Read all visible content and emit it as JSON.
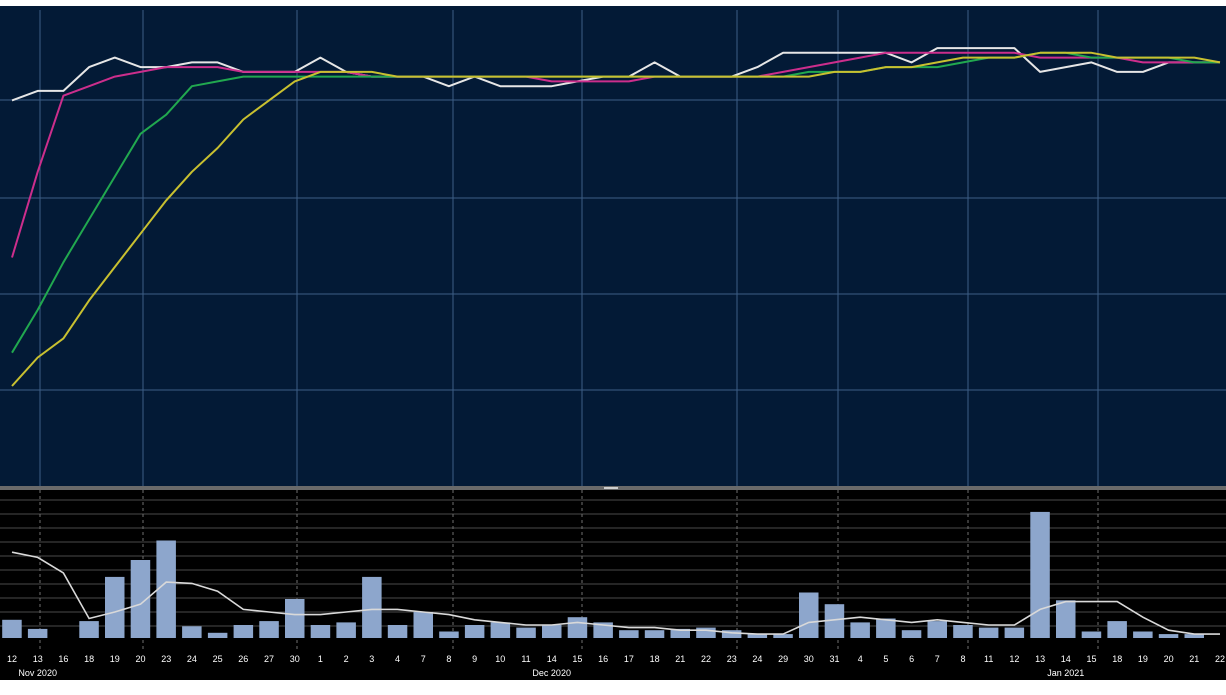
{
  "chart_data": [
    {
      "type": "line",
      "title": "",
      "grid": true,
      "colors": {
        "background": "#031a36",
        "grid": "#3d5e86",
        "price": "#e6e6e6",
        "ma_short": "#cc2e8c",
        "ma_mid": "#21a84f",
        "ma_long": "#c8c030"
      },
      "y_range": [
        0,
        100
      ],
      "x": [
        "12",
        "13",
        "16",
        "18",
        "19",
        "20",
        "23",
        "24",
        "25",
        "26",
        "27",
        "30",
        "1",
        "2",
        "3",
        "4",
        "7",
        "8",
        "9",
        "10",
        "11",
        "14",
        "15",
        "16",
        "17",
        "18",
        "21",
        "22",
        "23",
        "24",
        "29",
        "30",
        "31",
        "4",
        "5",
        "6",
        "7",
        "8",
        "11",
        "12",
        "13",
        "14",
        "15",
        "18",
        "19",
        "20",
        "21",
        "22"
      ],
      "series": [
        {
          "key": "price",
          "values": [
            81,
            83,
            83,
            88,
            90,
            88,
            88,
            89,
            89,
            87,
            87,
            87,
            90,
            87,
            86,
            86,
            86,
            84,
            86,
            84,
            84,
            84,
            85,
            86,
            86,
            89,
            86,
            86,
            86,
            88,
            91,
            91,
            91,
            91,
            91,
            89,
            92,
            92,
            92,
            92,
            87,
            88,
            89,
            87,
            87,
            89,
            89,
            89
          ]
        },
        {
          "key": "ma_short",
          "values": [
            48,
            66,
            82,
            84,
            86,
            87,
            88,
            88,
            88,
            87,
            87,
            87,
            87,
            87,
            86,
            86,
            86,
            86,
            86,
            86,
            86,
            85,
            85,
            85,
            85,
            86,
            86,
            86,
            86,
            86,
            87,
            88,
            89,
            90,
            91,
            91,
            91,
            91,
            91,
            91,
            90,
            90,
            90,
            90,
            89,
            89,
            89,
            89
          ]
        },
        {
          "key": "ma_mid",
          "values": [
            28,
            37,
            47,
            56,
            65,
            74,
            78,
            84,
            85,
            86,
            86,
            86,
            86,
            86,
            86,
            86,
            86,
            86,
            86,
            86,
            86,
            86,
            86,
            86,
            86,
            86,
            86,
            86,
            86,
            86,
            86,
            87,
            87,
            87,
            88,
            88,
            88,
            89,
            90,
            90,
            91,
            91,
            90,
            90,
            90,
            90,
            89,
            89
          ]
        },
        {
          "key": "ma_long",
          "values": [
            21,
            27,
            31,
            39,
            46,
            53,
            60,
            66,
            71,
            77,
            81,
            85,
            87,
            87,
            87,
            86,
            86,
            86,
            86,
            86,
            86,
            86,
            86,
            86,
            86,
            86,
            86,
            86,
            86,
            86,
            86,
            86,
            87,
            87,
            88,
            88,
            89,
            90,
            90,
            90,
            91,
            91,
            91,
            90,
            90,
            90,
            90,
            89
          ]
        }
      ]
    },
    {
      "type": "bar",
      "title": "",
      "grid": true,
      "colors": {
        "background": "#000000",
        "bar": "#8da6cc",
        "line": "#d9d9d9",
        "grid": "#4a4a4a"
      },
      "y_range": [
        0,
        100
      ],
      "x_months": [
        {
          "label": "Nov 2020",
          "index": 1
        },
        {
          "label": "Dec 2020",
          "index": 21
        },
        {
          "label": "Jan 2021",
          "index": 41
        }
      ],
      "values": [
        14,
        7,
        0,
        13,
        47,
        60,
        75,
        9,
        4,
        10,
        13,
        30,
        10,
        12,
        47,
        10,
        20,
        5,
        10,
        12,
        8,
        10,
        16,
        12,
        6,
        6,
        7,
        8,
        6,
        3,
        3,
        35,
        26,
        12,
        15,
        6,
        13,
        10,
        8,
        8,
        97,
        29,
        5,
        13,
        5,
        3,
        3,
        0
      ],
      "trend": [
        66,
        62,
        50,
        15,
        20,
        26,
        43,
        42,
        36,
        22,
        20,
        18,
        18,
        20,
        22,
        22,
        20,
        18,
        14,
        12,
        10,
        10,
        12,
        10,
        8,
        8,
        6,
        6,
        4,
        3,
        3,
        12,
        14,
        16,
        14,
        12,
        14,
        12,
        10,
        10,
        22,
        28,
        28,
        28,
        16,
        6,
        3,
        3
      ]
    }
  ]
}
